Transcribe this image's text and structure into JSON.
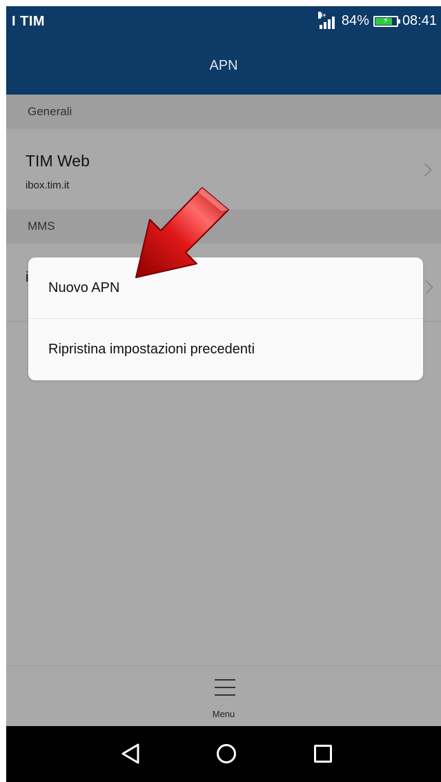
{
  "status_bar": {
    "carrier": "I TIM",
    "network_type": "H+",
    "battery_percent": "84%",
    "battery_level": 0.84,
    "time": "08:41",
    "icons": [
      "signal-icon",
      "battery-icon"
    ]
  },
  "app_bar": {
    "title": "APN"
  },
  "sections": {
    "general": {
      "header": "Generali",
      "item": {
        "title": "TIM Web",
        "subtitle": "ibox.tim.it"
      }
    },
    "mms": {
      "header": "MMS",
      "item": {
        "title": "i",
        "subtitle": ""
      }
    }
  },
  "dialog": {
    "items": [
      {
        "label": "Nuovo APN"
      },
      {
        "label": "Ripristina impostazioni precedenti"
      }
    ]
  },
  "annotation": {
    "type": "red-arrow",
    "color": "#cc0000",
    "points_to": "Nuovo APN"
  },
  "bottom_menu": {
    "label": "Menu",
    "icon": "hamburger-menu-icon"
  },
  "nav_bar": {
    "icons": [
      "back-icon",
      "home-icon",
      "recent-apps-icon"
    ]
  },
  "colors": {
    "header_blue": "#0d3a66",
    "overlay_gray": "#a9a9a9",
    "dialog_bg": "#fafafa"
  }
}
